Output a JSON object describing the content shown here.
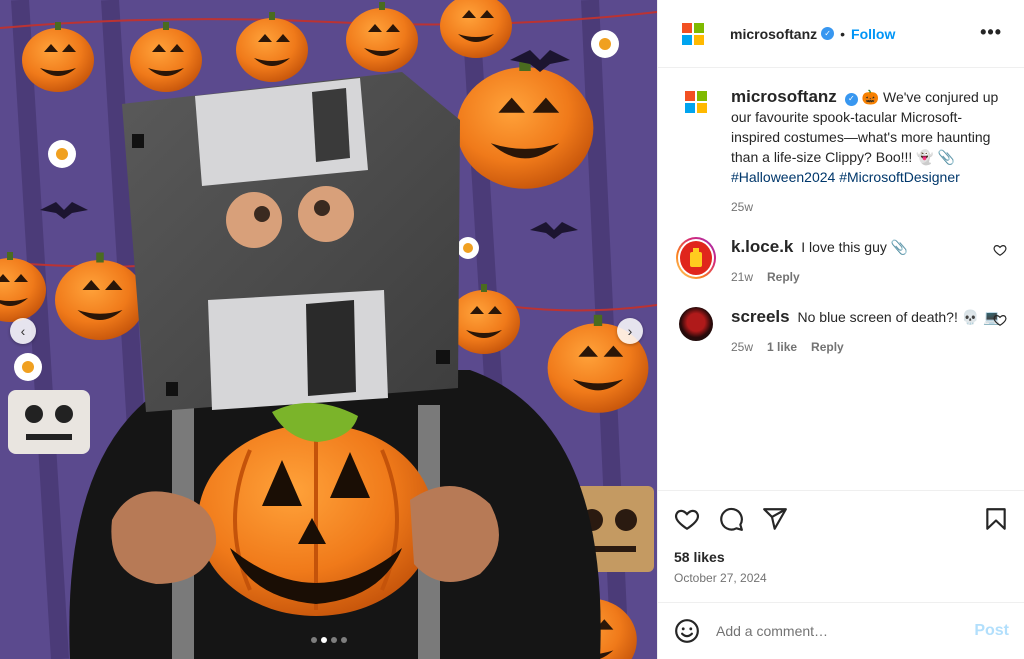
{
  "media": {
    "slide_count": 4,
    "active_slide": 2,
    "prev_arrow": "‹",
    "next_arrow": "›"
  },
  "header": {
    "username": "microsoftanz",
    "verified_mark": "✓",
    "separator": "•",
    "follow_label": "Follow",
    "more_label": "•••"
  },
  "caption": {
    "username": "microsoftanz",
    "text": "🎃 We've conjured up our favourite spook-tacular Microsoft-inspired costumes—what's more haunting than a life-size Clippy? Boo!!! 👻 📎",
    "hashtags": "#Halloween2024 #MicrosoftDesigner",
    "time": "25w"
  },
  "comments": [
    {
      "username": "k.loce.k",
      "text": "I love this guy 📎",
      "time": "21w",
      "likes": "",
      "reply_label": "Reply"
    },
    {
      "username": "screels",
      "text": "No blue screen of death?! 💀 💻",
      "time": "25w",
      "likes": "1 like",
      "reply_label": "Reply"
    }
  ],
  "actions": {
    "likes": "58 likes",
    "date": "October 27, 2024",
    "icons": [
      "heart-icon",
      "comment-icon",
      "share-icon",
      "bookmark-icon"
    ]
  },
  "composer": {
    "placeholder": "Add a comment…",
    "post_label": "Post"
  },
  "colors": {
    "follow_blue": "#0095f6",
    "hashtag_navy": "#00376b",
    "post_disabled": "#b2dffc",
    "pumpkin_orange": "#f07a1a",
    "backdrop_purple": "#5b4a8e"
  }
}
